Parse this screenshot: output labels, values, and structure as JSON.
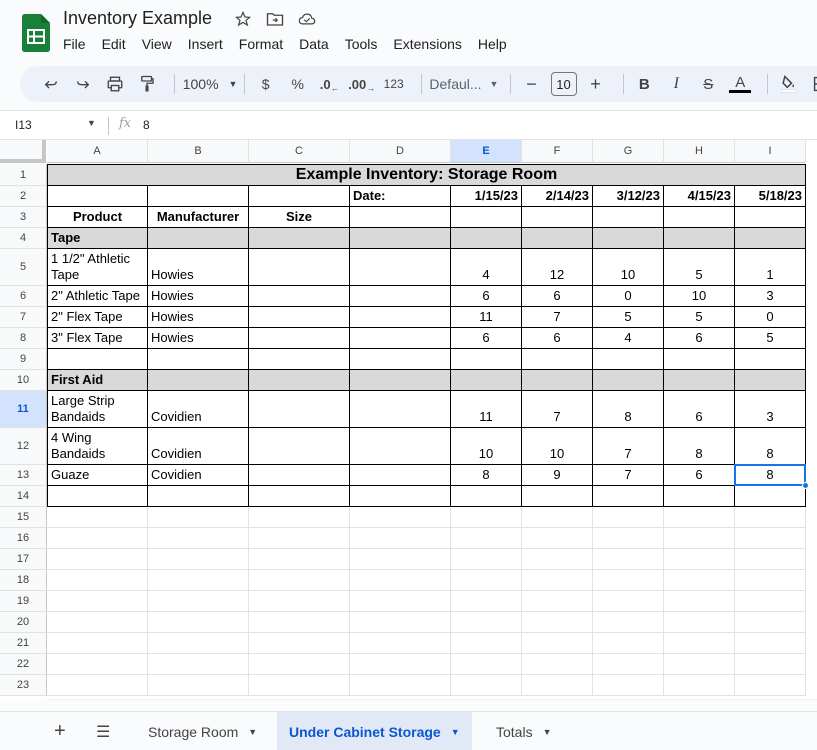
{
  "app": {
    "title": "Inventory Example",
    "accent_color": "#1a73e8",
    "logo_color": "#188038",
    "title_icons": [
      "star-icon",
      "move-to-folder-icon",
      "cloud-saved-icon"
    ]
  },
  "menu": [
    "File",
    "Edit",
    "View",
    "Insert",
    "Format",
    "Data",
    "Tools",
    "Extensions",
    "Help"
  ],
  "toolbar": {
    "zoom": "100%",
    "currency": "$",
    "percent": "%",
    "decrease_decimal": ".0",
    "increase_decimal": ".00",
    "number_format": "123",
    "font": "Defaul...",
    "font_size": "10",
    "minus": "−",
    "plus": "+",
    "bold": "B",
    "italic": "I",
    "strikethrough": "S",
    "text_color": "A"
  },
  "formula_bar": {
    "name_box": "I13",
    "fx_label": "fx",
    "value": "8"
  },
  "grid": {
    "columns": [
      "A",
      "B",
      "C",
      "D",
      "E",
      "F",
      "G",
      "H",
      "I"
    ],
    "selected_column": "E",
    "rows": [
      "1",
      "2",
      "3",
      "4",
      "5",
      "6",
      "7",
      "8",
      "9",
      "10",
      "11",
      "12",
      "13",
      "14",
      "15",
      "16",
      "17",
      "18",
      "19",
      "20",
      "21",
      "22",
      "23"
    ],
    "selected_row": "11",
    "selected_cell": "I13",
    "title": "Example Inventory: Storage Room",
    "date_label": "Date:",
    "dates": [
      "1/15/23",
      "2/14/23",
      "3/12/23",
      "4/15/23",
      "5/18/23"
    ],
    "headers": [
      "Product",
      "Manufacturer",
      "Size"
    ],
    "sections": [
      {
        "name": "Tape",
        "items": [
          {
            "product": "1 1/2\" Athletic Tape",
            "manufacturer": "Howies",
            "size": "",
            "counts": [
              "4",
              "12",
              "10",
              "5",
              "1"
            ]
          },
          {
            "product": "2\" Athletic Tape",
            "manufacturer": "Howies",
            "size": "",
            "counts": [
              "6",
              "6",
              "0",
              "10",
              "3"
            ]
          },
          {
            "product": "2\" Flex Tape",
            "manufacturer": "Howies",
            "size": "",
            "counts": [
              "11",
              "7",
              "5",
              "5",
              "0"
            ]
          },
          {
            "product": "3\" Flex Tape",
            "manufacturer": "Howies",
            "size": "",
            "counts": [
              "6",
              "6",
              "4",
              "6",
              "5"
            ]
          }
        ]
      },
      {
        "name": "First Aid",
        "items": [
          {
            "product": "Large Strip Bandaids",
            "manufacturer": "Covidien",
            "size": "",
            "counts": [
              "11",
              "7",
              "8",
              "6",
              "3"
            ]
          },
          {
            "product": "4 Wing Bandaids",
            "manufacturer": "Covidien",
            "size": "",
            "counts": [
              "10",
              "10",
              "7",
              "8",
              "8"
            ]
          },
          {
            "product": "Guaze",
            "manufacturer": "Covidien",
            "size": "",
            "counts": [
              "8",
              "9",
              "7",
              "6",
              "8"
            ]
          }
        ]
      }
    ]
  },
  "sheets": {
    "tabs": [
      "Storage Room",
      "Under Cabinet Storage",
      "Totals"
    ],
    "active": "Under Cabinet Storage"
  }
}
